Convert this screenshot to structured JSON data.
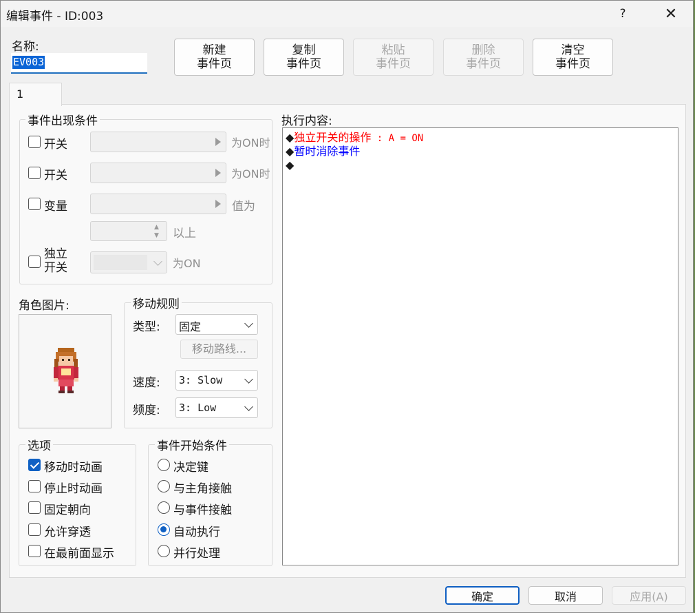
{
  "window": {
    "title": "编辑事件 - ID:003",
    "help": "?",
    "close": "✕"
  },
  "name": {
    "label": "名称:",
    "value": "EV003"
  },
  "page_buttons": [
    {
      "line1": "新建",
      "line2": "事件页",
      "enabled": true
    },
    {
      "line1": "复制",
      "line2": "事件页",
      "enabled": true
    },
    {
      "line1": "粘贴",
      "line2": "事件页",
      "enabled": false
    },
    {
      "line1": "删除",
      "line2": "事件页",
      "enabled": false
    },
    {
      "line1": "清空",
      "line2": "事件页",
      "enabled": true
    }
  ],
  "tab": {
    "label": "1"
  },
  "conditions": {
    "title": "事件出现条件",
    "switch1": {
      "label": "开关",
      "suffix": "为ON时",
      "checked": false
    },
    "switch2": {
      "label": "开关",
      "suffix": "为ON时",
      "checked": false
    },
    "variable": {
      "label": "变量",
      "suffix": "值为",
      "compare_suffix": "以上",
      "checked": false
    },
    "self_switch": {
      "label_line1": "独立",
      "label_line2": "开关",
      "suffix": "为ON",
      "checked": false
    }
  },
  "graphic": {
    "label": "角色图片:"
  },
  "movement": {
    "title": "移动规则",
    "type_label": "类型:",
    "type_value": "固定",
    "route_button": "移动路线...",
    "speed_label": "速度:",
    "speed_value": "3: Slow",
    "freq_label": "频度:",
    "freq_value": "3: Low"
  },
  "options": {
    "title": "选项",
    "items": [
      {
        "label": "移动时动画",
        "checked": true
      },
      {
        "label": "停止时动画",
        "checked": false
      },
      {
        "label": "固定朝向",
        "checked": false
      },
      {
        "label": "允许穿透",
        "checked": false
      },
      {
        "label": "在最前面显示",
        "checked": false
      }
    ]
  },
  "trigger": {
    "title": "事件开始条件",
    "items": [
      {
        "label": "决定键",
        "selected": false
      },
      {
        "label": "与主角接触",
        "selected": false
      },
      {
        "label": "与事件接触",
        "selected": false
      },
      {
        "label": "自动执行",
        "selected": true
      },
      {
        "label": "并行处理",
        "selected": false
      }
    ]
  },
  "contents": {
    "label": "执行内容:",
    "commands": [
      {
        "bullet": "◆",
        "text": "独立开关的操作",
        "detail": " : A = ON",
        "color": "#ff0000"
      },
      {
        "bullet": "◆",
        "text": "暂时消除事件",
        "detail": "",
        "color": "#0000ff"
      },
      {
        "bullet": "◆",
        "text": "",
        "detail": "",
        "color": "#000000"
      }
    ]
  },
  "footer": {
    "ok": "确定",
    "cancel": "取消",
    "apply": "应用(A)"
  }
}
